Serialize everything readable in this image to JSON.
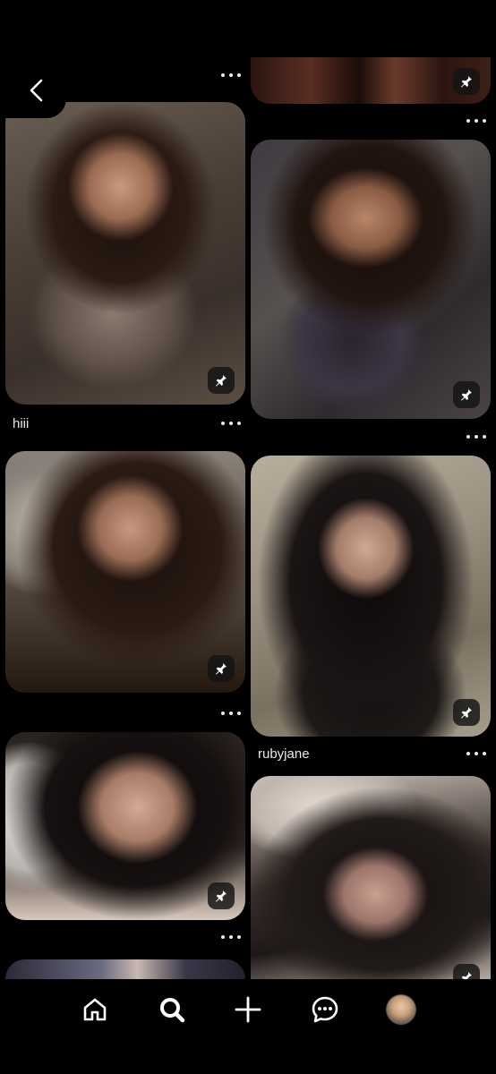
{
  "pins": [
    {
      "id": "pin-top-right",
      "caption": ""
    },
    {
      "id": "pin-left-1",
      "caption": "hiii"
    },
    {
      "id": "pin-right-1",
      "caption": ""
    },
    {
      "id": "pin-left-2",
      "caption": ""
    },
    {
      "id": "pin-right-2",
      "caption": "rubyjane"
    },
    {
      "id": "pin-left-3",
      "caption": ""
    },
    {
      "id": "pin-right-3",
      "caption": ""
    },
    {
      "id": "pin-left-4",
      "caption": ""
    }
  ],
  "nav": {
    "items": [
      "home-icon",
      "search-icon",
      "create-icon",
      "messages-icon",
      "profile-avatar"
    ],
    "active": "search-icon"
  },
  "colors": {
    "background": "#000000",
    "overlay": "#141414",
    "text": "#e8e8e8"
  }
}
